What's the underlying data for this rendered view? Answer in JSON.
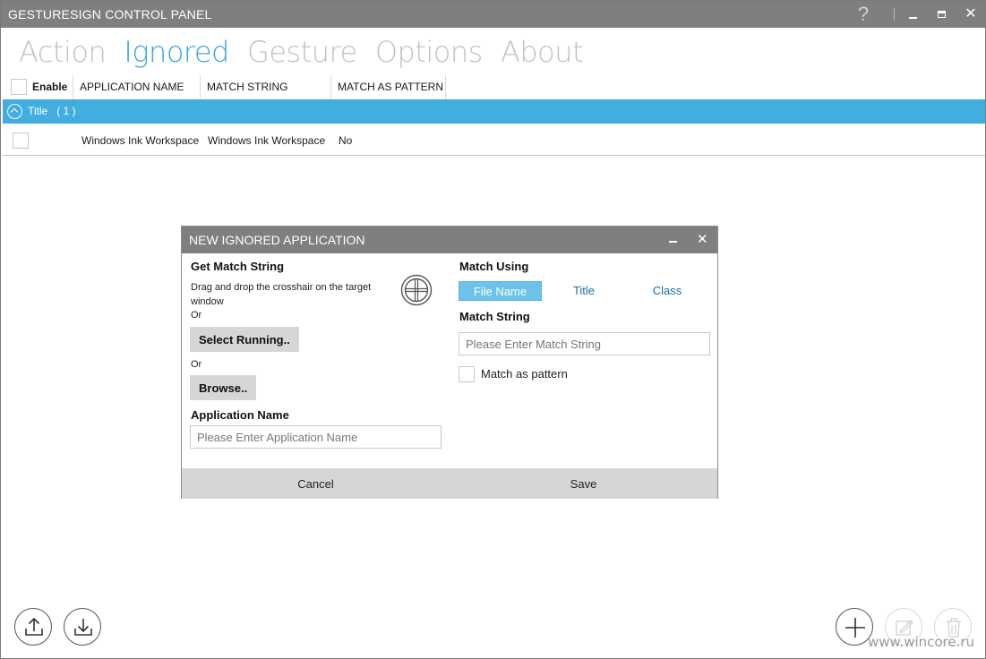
{
  "window": {
    "title": "GESTURESIGN CONTROL PANEL",
    "help_glyph": "?",
    "close_glyph": "✕"
  },
  "nav": {
    "tabs": [
      "Action",
      "Ignored",
      "Gesture",
      "Options",
      "About"
    ],
    "active": "Ignored"
  },
  "grid": {
    "columns": {
      "enable": "Enable",
      "app_name": "APPLICATION NAME",
      "match_string": "MATCH STRING",
      "match_as_pattern": "MATCH AS PATTERN"
    },
    "group": {
      "label": "Title",
      "count": "( 1 )"
    },
    "rows": [
      {
        "enabled": false,
        "app_name": "Windows Ink Workspace",
        "match_string": "Windows Ink Workspace",
        "match_as_pattern": "No"
      }
    ]
  },
  "dialog": {
    "title": "NEW IGNORED APPLICATION",
    "close_glyph": "✕",
    "get_match_string": "Get Match String",
    "drag_instruction": "Drag and drop the crosshair on the target window",
    "or1": "Or",
    "select_running": "Select Running..",
    "or2": "Or",
    "browse": "Browse..",
    "application_name_label": "Application Name",
    "application_name_placeholder": "Please Enter Application Name",
    "application_name_value": "",
    "match_using_label": "Match Using",
    "match_using_options": [
      "File Name",
      "Title",
      "Class"
    ],
    "match_using_selected": "File Name",
    "match_string_label": "Match String",
    "match_string_placeholder": "Please Enter Match String",
    "match_string_value": "",
    "match_as_pattern_label": "Match as pattern",
    "match_as_pattern_checked": false,
    "cancel": "Cancel",
    "save": "Save"
  },
  "toolbar": {
    "left": [
      "upload-icon",
      "download-icon"
    ],
    "right": [
      "add-icon",
      "edit-icon",
      "delete-icon"
    ]
  },
  "watermark": "www.wincore.ru",
  "colors": {
    "accent": "#41ade0",
    "titlebar": "#7f7f7f",
    "active_tab": "#3aa6db",
    "inactive_tab": "#c2c2c2"
  }
}
